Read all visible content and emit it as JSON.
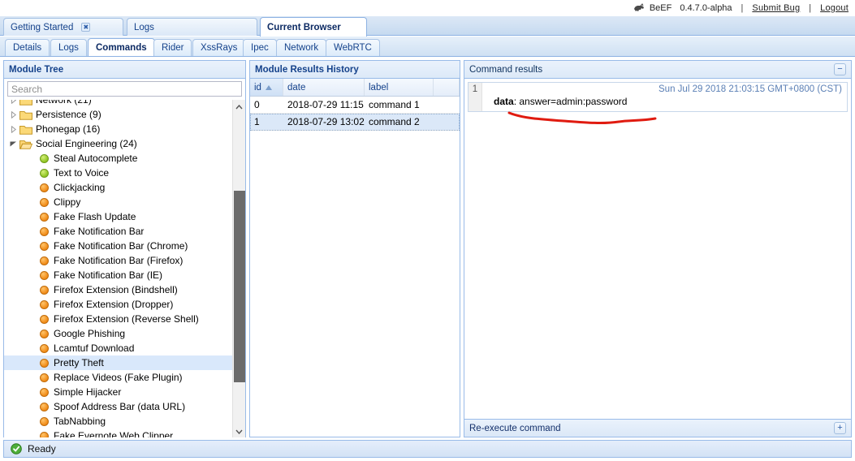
{
  "header": {
    "brand_icon": "beef-icon",
    "brand": "BeEF",
    "version": "0.4.7.0-alpha",
    "sep1": "|",
    "submit_bug": "Submit  Bug",
    "sep2": "|",
    "logout": "Logout"
  },
  "main_tabs": [
    {
      "label": "Getting Started",
      "active": false,
      "closable": true,
      "close_glyph": "✖"
    },
    {
      "label": "Logs",
      "active": false,
      "closable": false
    },
    {
      "label": "Current Browser",
      "active": true,
      "closable": false
    }
  ],
  "sub_tabs": [
    {
      "label": "Details",
      "active": false
    },
    {
      "label": "Logs",
      "active": false
    },
    {
      "label": "Commands",
      "active": true
    },
    {
      "label": "Rider",
      "active": false
    },
    {
      "label": "XssRays",
      "active": false
    },
    {
      "label": "Ipec",
      "active": false
    },
    {
      "label": "Network",
      "active": false
    },
    {
      "label": "WebRTC",
      "active": false
    }
  ],
  "module_tree": {
    "title": "Module Tree",
    "search_placeholder": "Search",
    "search_value": "",
    "scroll_up_glyph": "⌃",
    "scroll_down_glyph": "⌄",
    "nodes": [
      {
        "type": "folder",
        "label": "Network (21)",
        "expanded": false,
        "clipped_top": true
      },
      {
        "type": "folder",
        "label": "Persistence (9)",
        "expanded": false
      },
      {
        "type": "folder",
        "label": "Phonegap (16)",
        "expanded": false
      },
      {
        "type": "folder",
        "label": "Social Engineering (24)",
        "expanded": true
      },
      {
        "type": "module",
        "label": "Steal Autocomplete",
        "status": "green"
      },
      {
        "type": "module",
        "label": "Text to Voice",
        "status": "green"
      },
      {
        "type": "module",
        "label": "Clickjacking",
        "status": "orange"
      },
      {
        "type": "module",
        "label": "Clippy",
        "status": "orange"
      },
      {
        "type": "module",
        "label": "Fake Flash Update",
        "status": "orange"
      },
      {
        "type": "module",
        "label": "Fake Notification Bar",
        "status": "orange"
      },
      {
        "type": "module",
        "label": "Fake Notification Bar (Chrome)",
        "status": "orange"
      },
      {
        "type": "module",
        "label": "Fake Notification Bar (Firefox)",
        "status": "orange"
      },
      {
        "type": "module",
        "label": "Fake Notification Bar (IE)",
        "status": "orange"
      },
      {
        "type": "module",
        "label": "Firefox Extension (Bindshell)",
        "status": "orange"
      },
      {
        "type": "module",
        "label": "Firefox Extension (Dropper)",
        "status": "orange"
      },
      {
        "type": "module",
        "label": "Firefox Extension (Reverse Shell)",
        "status": "orange"
      },
      {
        "type": "module",
        "label": "Google Phishing",
        "status": "orange"
      },
      {
        "type": "module",
        "label": "Lcamtuf Download",
        "status": "orange"
      },
      {
        "type": "module",
        "label": "Pretty Theft",
        "status": "orange",
        "selected": true
      },
      {
        "type": "module",
        "label": "Replace Videos (Fake Plugin)",
        "status": "orange"
      },
      {
        "type": "module",
        "label": "Simple Hijacker",
        "status": "orange"
      },
      {
        "type": "module",
        "label": "Spoof Address Bar (data URL)",
        "status": "orange"
      },
      {
        "type": "module",
        "label": "TabNabbing",
        "status": "orange"
      },
      {
        "type": "module",
        "label": "Fake Evernote Web Clipper",
        "status": "orange",
        "clipped_bottom": true
      }
    ]
  },
  "history": {
    "title": "Module Results History",
    "columns": [
      {
        "key": "id",
        "label": "id",
        "sorted": true,
        "sort_dir": "asc",
        "sort_glyph": "▲"
      },
      {
        "key": "date",
        "label": "date",
        "sorted": false
      },
      {
        "key": "label",
        "label": "label",
        "sorted": false
      }
    ],
    "rows": [
      {
        "id": "0",
        "date": "2018-07-29 11:15",
        "label": "command 1",
        "selected": false
      },
      {
        "id": "1",
        "date": "2018-07-29 13:02",
        "label": "command 2",
        "selected": true
      }
    ]
  },
  "results": {
    "title": "Command results",
    "collapse_glyph": "−",
    "entries": [
      {
        "number": "1",
        "timestamp": "Sun Jul 29 2018 21:03:15 GMT+0800 (CST)",
        "data_key": "data",
        "data_sep": ": ",
        "data_value": "answer=admin:password"
      }
    ],
    "footer_label": "Re-execute command",
    "footer_add_glyph": "+",
    "annotation_color": "#e01b10"
  },
  "statusbar": {
    "icon": "ok-check-icon",
    "text": "Ready"
  }
}
